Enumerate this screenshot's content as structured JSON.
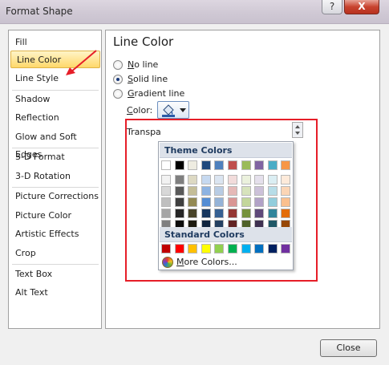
{
  "window": {
    "title": "Format Shape",
    "help_label": "?",
    "close_label": "X"
  },
  "sidebar": {
    "items": [
      {
        "label": "Fill"
      },
      {
        "label": "Line Color"
      },
      {
        "label": "Line Style"
      },
      {
        "label": "Shadow"
      },
      {
        "label": "Reflection"
      },
      {
        "label": "Glow and Soft Edges"
      },
      {
        "label": "3-D Format"
      },
      {
        "label": "3-D Rotation"
      },
      {
        "label": "Picture Corrections"
      },
      {
        "label": "Picture Color"
      },
      {
        "label": "Artistic Effects"
      },
      {
        "label": "Crop"
      },
      {
        "label": "Text Box"
      },
      {
        "label": "Alt Text"
      }
    ],
    "selected": "Line Color"
  },
  "content": {
    "title": "Line Color",
    "options": [
      {
        "key": "N",
        "rest": "o line",
        "checked": false
      },
      {
        "key": "S",
        "rest": "olid line",
        "checked": true
      },
      {
        "key": "G",
        "rest": "radient line",
        "checked": false
      }
    ],
    "color_key": "C",
    "color_rest": "olor:",
    "transparency_label": "Transpa",
    "color_icon": "paint-bucket-icon",
    "accent_color": "#e61e28"
  },
  "palette": {
    "theme_header": "Theme Colors",
    "standard_header": "Standard Colors",
    "more_colors": {
      "key": "M",
      "rest": "ore Colors..."
    },
    "theme_top": [
      "#ffffff",
      "#000000",
      "#eeece1",
      "#1f497d",
      "#4f81bd",
      "#c0504d",
      "#9bbb59",
      "#8064a2",
      "#4bacc6",
      "#f79646"
    ],
    "theme_shades": [
      [
        "#f2f2f2",
        "#7f7f7f",
        "#ddd9c3",
        "#c6d9f0",
        "#dbe5f1",
        "#f2dcdb",
        "#ebf1dd",
        "#e5e0ec",
        "#dbeef3",
        "#fdeada"
      ],
      [
        "#d8d8d8",
        "#595959",
        "#c4bd97",
        "#8db3e2",
        "#b8cce4",
        "#e5b9b7",
        "#d7e3bc",
        "#ccc1d9",
        "#b7dde8",
        "#fbd5b5"
      ],
      [
        "#bfbfbf",
        "#3f3f3f",
        "#938953",
        "#548dd4",
        "#95b3d7",
        "#d99694",
        "#c3d69b",
        "#b2a2c7",
        "#92cddc",
        "#fac08f"
      ],
      [
        "#a5a5a5",
        "#262626",
        "#494429",
        "#17365d",
        "#366092",
        "#953734",
        "#76923c",
        "#5f497a",
        "#31859b",
        "#e36c09"
      ],
      [
        "#7f7f7f",
        "#0c0c0c",
        "#1d1b10",
        "#0f243e",
        "#244061",
        "#632423",
        "#4f6128",
        "#3f3151",
        "#205867",
        "#974806"
      ]
    ],
    "standard": [
      "#c00000",
      "#ff0000",
      "#ffc000",
      "#ffff00",
      "#92d050",
      "#00b050",
      "#00b0f0",
      "#0070c0",
      "#002060",
      "#7030a0"
    ],
    "more_icon": "color-wheel-icon"
  },
  "footer": {
    "close_label": "Close"
  }
}
